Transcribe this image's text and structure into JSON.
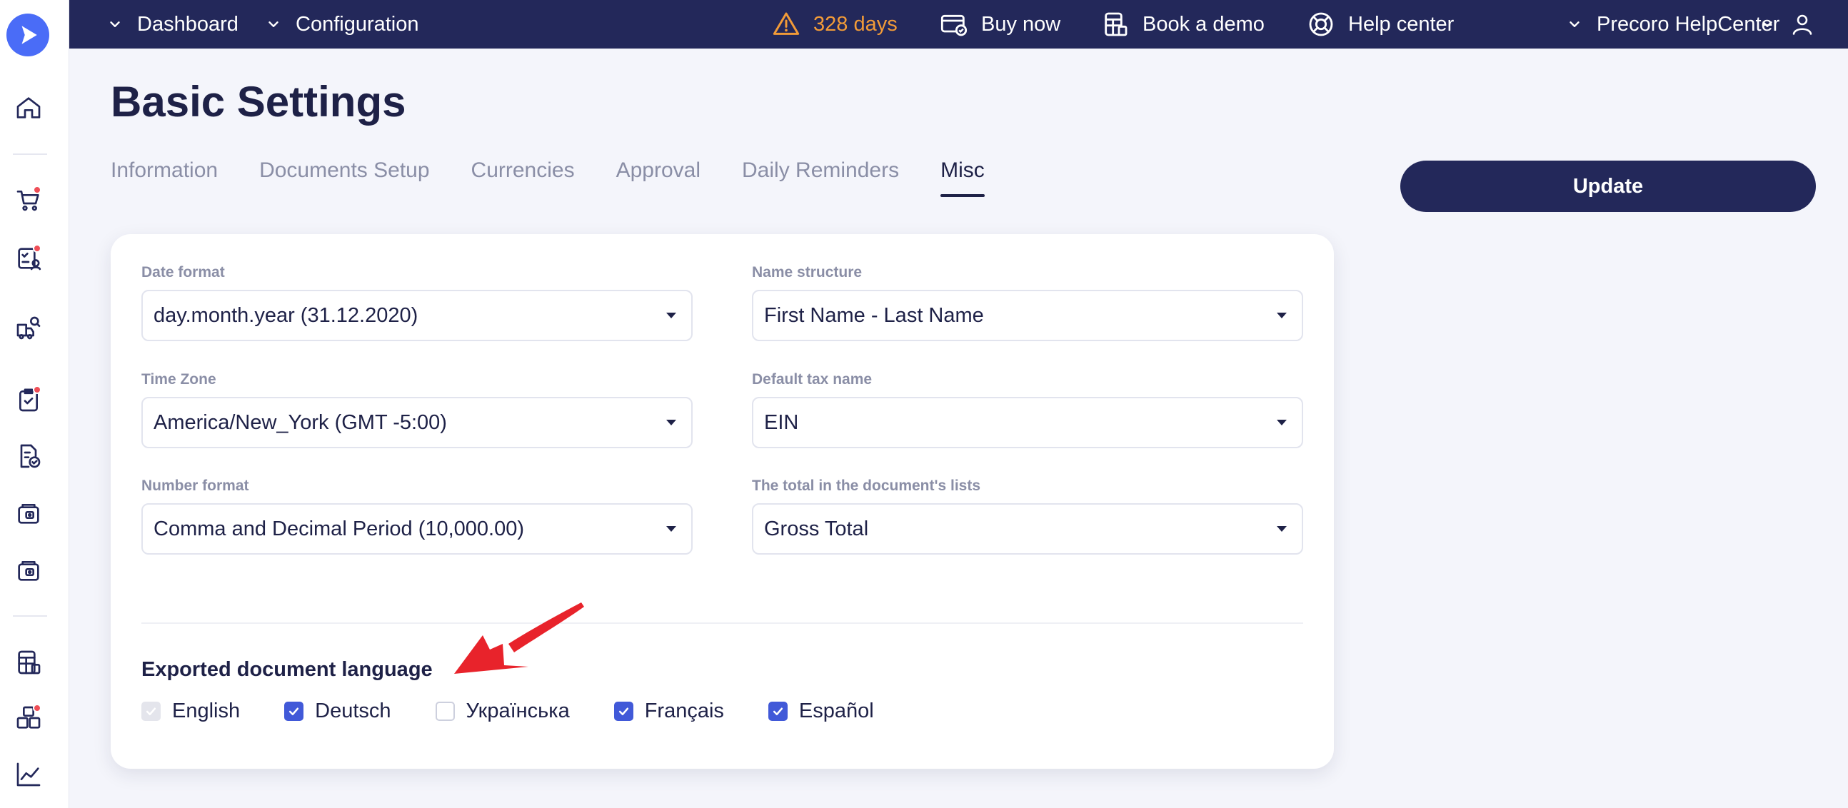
{
  "colors": {
    "topbar": "#23285a",
    "page_bg": "#f4f5fb",
    "accent": "#4159d8",
    "trial_warning": "#f29b38",
    "notification_dot": "#ef4e57",
    "annotation_arrow": "#e8232b"
  },
  "sidebar": {
    "logo_icon": "precoro-logo-icon",
    "items": [
      {
        "icon": "home-icon",
        "badge": false
      },
      {
        "icon": "shopping-cart-icon",
        "badge": true
      },
      {
        "icon": "approval-list-icon",
        "badge": true
      },
      {
        "icon": "truck-search-icon",
        "badge": false
      },
      {
        "icon": "clipboard-check-icon",
        "badge": true
      },
      {
        "icon": "invoice-check-icon",
        "badge": false
      },
      {
        "icon": "wallet-icon",
        "badge": false
      },
      {
        "icon": "wallet-alt-icon",
        "badge": false
      },
      {
        "icon": "spreadsheet-icon",
        "badge": false
      },
      {
        "icon": "boxes-icon",
        "badge": true
      },
      {
        "icon": "analytics-chart-icon",
        "badge": false
      }
    ]
  },
  "topbar": {
    "dashboard": "Dashboard",
    "configuration": "Configuration",
    "trial": "328 days",
    "buy_now": "Buy now",
    "book_demo": "Book a demo",
    "help_center": "Help center",
    "company": "Precoro HelpCenter"
  },
  "page": {
    "title": "Basic Settings",
    "update": "Update",
    "active_tab": "Misc",
    "tabs": [
      "Information",
      "Documents Setup",
      "Currencies",
      "Approval",
      "Daily Reminders",
      "Misc"
    ]
  },
  "form": {
    "date_format": {
      "label": "Date format",
      "value": "day.month.year (31.12.2020)"
    },
    "name_structure": {
      "label": "Name structure",
      "value": "First Name - Last Name"
    },
    "time_zone": {
      "label": "Time Zone",
      "value": "America/New_York (GMT -5:00)"
    },
    "default_tax": {
      "label": "Default tax name",
      "value": "EIN"
    },
    "number_format": {
      "label": "Number format",
      "value": "Comma and Decimal Period (10,000.00)"
    },
    "total_in_lists": {
      "label": "The total in the document's lists",
      "value": "Gross Total"
    }
  },
  "export_language": {
    "title": "Exported document language",
    "options": [
      {
        "label": "English",
        "checked": true,
        "disabled": true
      },
      {
        "label": "Deutsch",
        "checked": true,
        "disabled": false
      },
      {
        "label": "Українська",
        "checked": false,
        "disabled": false
      },
      {
        "label": "Français",
        "checked": true,
        "disabled": false
      },
      {
        "label": "Español",
        "checked": true,
        "disabled": false
      }
    ]
  }
}
